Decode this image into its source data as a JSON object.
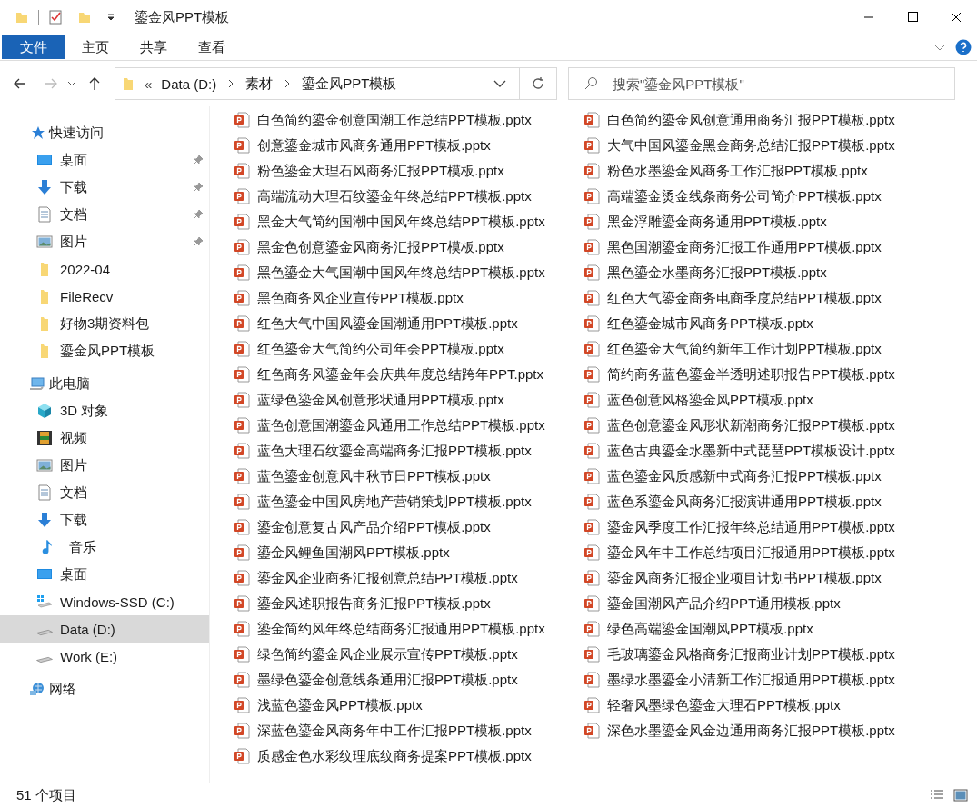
{
  "window": {
    "title": "鎏金风PPT模板"
  },
  "ribbon": {
    "tabs": [
      {
        "label": "文件",
        "kind": "file"
      },
      {
        "label": "主页",
        "kind": "tab"
      },
      {
        "label": "共享",
        "kind": "tab"
      },
      {
        "label": "查看",
        "kind": "tab"
      }
    ]
  },
  "address_bar": {
    "overflow": "«",
    "crumbs": [
      "Data (D:)",
      "素材",
      "鎏金风PPT模板"
    ]
  },
  "search": {
    "placeholder": "搜索\"鎏金风PPT模板\""
  },
  "sidebar": {
    "sections": [
      {
        "label": "快速访问",
        "kind": "star",
        "selected": false,
        "children": [
          {
            "label": "桌面",
            "kind": "desktop",
            "pinned": true,
            "selected": false
          },
          {
            "label": "下载",
            "kind": "download",
            "pinned": true,
            "selected": false
          },
          {
            "label": "文档",
            "kind": "docs",
            "pinned": true,
            "selected": false
          },
          {
            "label": "图片",
            "kind": "pictures",
            "pinned": true,
            "selected": false
          },
          {
            "label": "2022-04",
            "kind": "folder",
            "pinned": false,
            "selected": false
          },
          {
            "label": "FileRecv",
            "kind": "folder",
            "pinned": false,
            "selected": false
          },
          {
            "label": "好物3期资料包",
            "kind": "folder",
            "pinned": false,
            "selected": false
          },
          {
            "label": "鎏金风PPT模板",
            "kind": "folder",
            "pinned": false,
            "selected": false
          }
        ]
      },
      {
        "label": "此电脑",
        "kind": "pc",
        "selected": false,
        "children": [
          {
            "label": "3D 对象",
            "kind": "cube",
            "pinned": false,
            "selected": false
          },
          {
            "label": "视频",
            "kind": "video",
            "pinned": false,
            "selected": false
          },
          {
            "label": "图片",
            "kind": "pictures",
            "pinned": false,
            "selected": false
          },
          {
            "label": "文档",
            "kind": "docs",
            "pinned": false,
            "selected": false
          },
          {
            "label": "下载",
            "kind": "download",
            "pinned": false,
            "selected": false
          },
          {
            "label": "音乐",
            "kind": "music",
            "pinned": false,
            "selected": false
          },
          {
            "label": "桌面",
            "kind": "desktop",
            "pinned": false,
            "selected": false
          },
          {
            "label": "Windows-SSD (C:)",
            "kind": "windrive",
            "pinned": false,
            "selected": false
          },
          {
            "label": "Data (D:)",
            "kind": "drive",
            "pinned": false,
            "selected": true
          },
          {
            "label": "Work (E:)",
            "kind": "drive",
            "pinned": false,
            "selected": false
          }
        ]
      },
      {
        "label": "网络",
        "kind": "network",
        "selected": false
      }
    ]
  },
  "files": [
    "白色简约鎏金创意国潮工作总结PPT模板.pptx",
    "创意鎏金城市风商务通用PPT模板.pptx",
    "粉色鎏金大理石风商务汇报PPT模板.pptx",
    "高端流动大理石纹鎏金年终总结PPT模板.pptx",
    "黑金大气简约国潮中国风年终总结PPT模板.pptx",
    "黑金色创意鎏金风商务汇报PPT模板.pptx",
    "黑色鎏金大气国潮中国风年终总结PPT模板.pptx",
    "黑色商务风企业宣传PPT模板.pptx",
    "红色大气中国风鎏金国潮通用PPT模板.pptx",
    "红色鎏金大气简约公司年会PPT模板.pptx",
    "红色商务风鎏金年会庆典年度总结跨年PPT.pptx",
    "蓝绿色鎏金风创意形状通用PPT模板.pptx",
    "蓝色创意国潮鎏金风通用工作总结PPT模板.pptx",
    "蓝色大理石纹鎏金高端商务汇报PPT模板.pptx",
    "蓝色鎏金创意风中秋节日PPT模板.pptx",
    "蓝色鎏金中国风房地产营销策划PPT模板.pptx",
    "鎏金创意复古风产品介绍PPT模板.pptx",
    "鎏金风鲤鱼国潮风PPT模板.pptx",
    "鎏金风企业商务汇报创意总结PPT模板.pptx",
    "鎏金风述职报告商务汇报PPT模板.pptx",
    "鎏金简约风年终总结商务汇报通用PPT模板.pptx",
    "绿色简约鎏金风企业展示宣传PPT模板.pptx",
    "墨绿色鎏金创意线条通用汇报PPT模板.pptx",
    "浅蓝色鎏金风PPT模板.pptx",
    "深蓝色鎏金风商务年中工作汇报PPT模板.pptx",
    "质感金色水彩纹理底纹商务提案PPT模板.pptx",
    "白色简约鎏金风创意通用商务汇报PPT模板.pptx",
    "大气中国风鎏金黑金商务总结汇报PPT模板.pptx",
    "粉色水墨鎏金风商务工作汇报PPT模板.pptx",
    "高端鎏金烫金线条商务公司简介PPT模板.pptx",
    "黑金浮雕鎏金商务通用PPT模板.pptx",
    "黑色国潮鎏金商务汇报工作通用PPT模板.pptx",
    "黑色鎏金水墨商务汇报PPT模板.pptx",
    "红色大气鎏金商务电商季度总结PPT模板.pptx",
    "红色鎏金城市风商务PPT模板.pptx",
    "红色鎏金大气简约新年工作计划PPT模板.pptx",
    "简约商务蓝色鎏金半透明述职报告PPT模板.pptx",
    "蓝色创意风格鎏金风PPT模板.pptx",
    "蓝色创意鎏金风形状新潮商务汇报PPT模板.pptx",
    "蓝色古典鎏金水墨新中式琵琶PPT模板设计.pptx",
    "蓝色鎏金风质感新中式商务汇报PPT模板.pptx",
    "蓝色系鎏金风商务汇报演讲通用PPT模板.pptx",
    "鎏金风季度工作汇报年终总结通用PPT模板.pptx",
    "鎏金风年中工作总结项目汇报通用PPT模板.pptx",
    "鎏金风商务汇报企业项目计划书PPT模板.pptx",
    "鎏金国潮风产品介绍PPT通用模板.pptx",
    "绿色高端鎏金国潮风PPT模板.pptx",
    "毛玻璃鎏金风格商务汇报商业计划PPT模板.pptx",
    "墨绿水墨鎏金小清新工作汇报通用PPT模板.pptx",
    "轻奢风墨绿色鎏金大理石PPT模板.pptx",
    "深色水墨鎏金风金边通用商务汇报PPT模板.pptx"
  ],
  "status_bar": {
    "count": "51 个项目"
  }
}
